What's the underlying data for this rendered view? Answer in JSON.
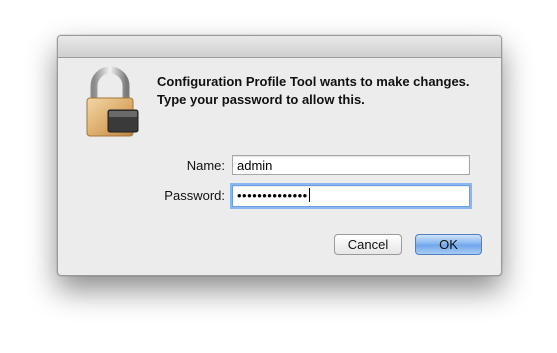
{
  "dialog": {
    "message": "Configuration Profile Tool wants to make changes. Type your password to allow this.",
    "name_label": "Name:",
    "name_value": "admin",
    "password_label": "Password:",
    "password_masked": "••••••••••••••",
    "cancel_label": "Cancel",
    "ok_label": "OK",
    "icon": "lock-icon"
  },
  "colors": {
    "dialog_background": "#ececec",
    "focus_ring": "#8ab7ef",
    "default_button": "#7fb1ed"
  }
}
